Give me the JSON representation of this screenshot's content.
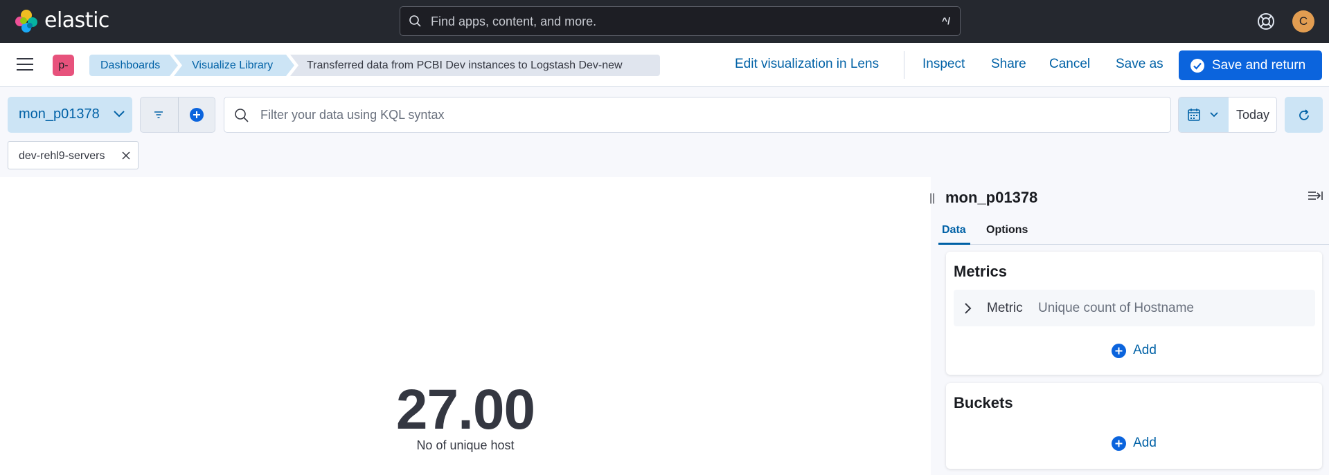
{
  "header": {
    "brand": "elastic",
    "search_placeholder": "Find apps, content, and more.",
    "search_shortcut": "^/",
    "avatar_initial": "C"
  },
  "nav": {
    "space_badge": "p-",
    "breadcrumbs": [
      {
        "label": "Dashboards"
      },
      {
        "label": "Visualize Library"
      },
      {
        "label": "Transferred data from PCBI Dev instances to Logstash Dev-new"
      }
    ],
    "actions": {
      "edit_lens": "Edit visualization in Lens",
      "inspect": "Inspect",
      "share": "Share",
      "cancel": "Cancel",
      "save_as": "Save as",
      "save_return": "Save and return"
    }
  },
  "query": {
    "data_view": "mon_p01378",
    "kql_placeholder": "Filter your data using KQL syntax",
    "date_label": "Today",
    "filter_pill": "dev-rehl9-servers"
  },
  "visualization": {
    "metric_value": "27.00",
    "metric_label": "No of unique host"
  },
  "sidebar": {
    "title": "mon_p01378",
    "tabs": [
      "Data",
      "Options"
    ],
    "metrics": {
      "heading": "Metrics",
      "item_type": "Metric",
      "item_desc": "Unique count of Hostname",
      "add_label": "Add"
    },
    "buckets": {
      "heading": "Buckets",
      "add_label": "Add"
    }
  },
  "colors": {
    "header_bg": "#25282f",
    "primary": "#0b64dd",
    "link": "#0061a6",
    "accent_badge": "#e7527c",
    "avatar": "#e29d51"
  }
}
